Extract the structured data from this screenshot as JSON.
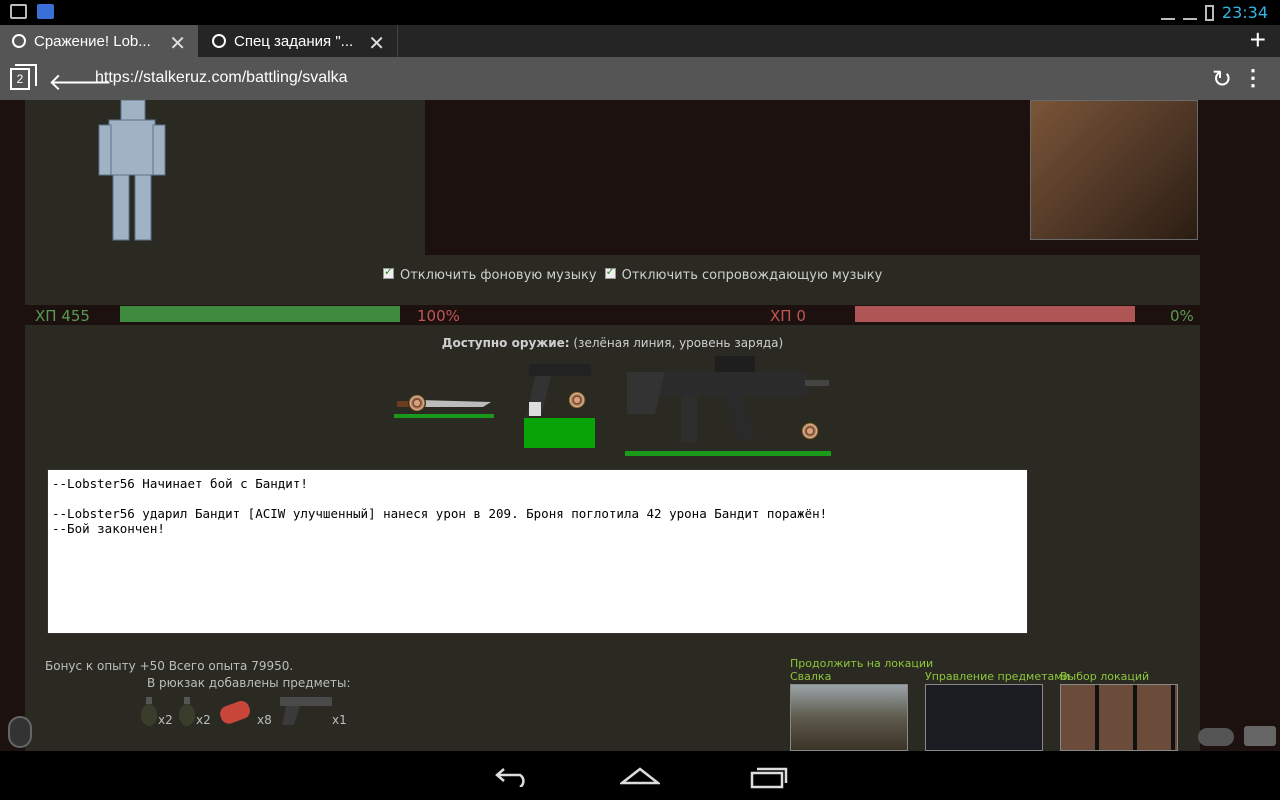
{
  "status_bar": {
    "time": "23:34"
  },
  "tabs": [
    {
      "title": "Сражение! Lob..."
    },
    {
      "title": "Спец задания \"..."
    }
  ],
  "address_bar": {
    "tab_count": "2",
    "url": "https://stalkeruz.com/battling/svalka"
  },
  "music": {
    "bg_label": "Отключить фоновую музыку",
    "accomp_label": "Отключить сопровождающую музыку"
  },
  "hp": {
    "player_label": "ХП 455",
    "player_pct": "100%",
    "player_fraction": 1.0,
    "enemy_label": "ХП 0",
    "enemy_pct": "0%",
    "enemy_fraction": 1.0
  },
  "weapons": {
    "title_bold": "Доступно оружие:",
    "title_rest": " (зелёная линия, уровень заряда)",
    "items": [
      {
        "name": "knife-icon"
      },
      {
        "name": "pistol-icon"
      },
      {
        "name": "rifle-icon"
      }
    ]
  },
  "log": {
    "lines": [
      "--Lobster56 Начинает бой с Бандит!",
      "",
      "--Lobster56 ударил Бандит [ACIW улучшенный] нанеся урон в 209. Броня поглотила 42 урона Бандит поражён!",
      "--Бой закончен!"
    ]
  },
  "rewards": {
    "bonus": "Бонус к опыту +50 Всего опыта 79950.",
    "added": "В рюкзак добавлены предметы:",
    "items": [
      {
        "icon": "grenade-icon",
        "count": "x2"
      },
      {
        "icon": "grenade-icon",
        "count": "x2"
      },
      {
        "icon": "medkit-icon",
        "count": "x8"
      },
      {
        "icon": "pistol-icon",
        "count": "x1"
      }
    ]
  },
  "links": {
    "continue": "Продолжить на локации",
    "location": "Свалка",
    "manage": "Управление предметами",
    "choose": "Выбор локаций"
  }
}
